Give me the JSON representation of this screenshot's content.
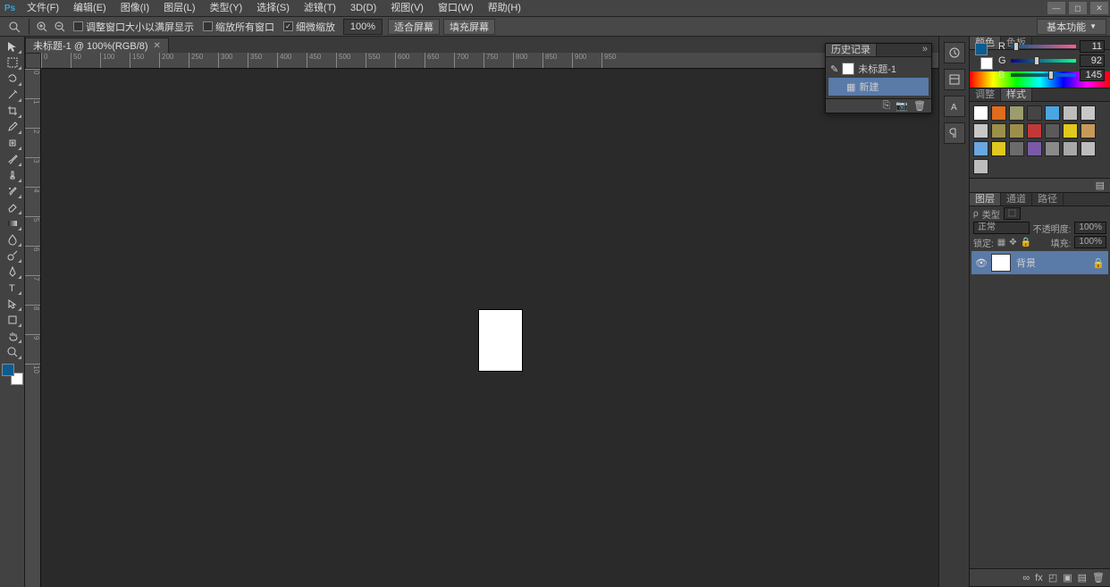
{
  "menu": {
    "items": [
      "文件(F)",
      "编辑(E)",
      "图像(I)",
      "图层(L)",
      "类型(Y)",
      "选择(S)",
      "滤镜(T)",
      "3D(D)",
      "视图(V)",
      "窗口(W)",
      "帮助(H)"
    ]
  },
  "window_controls": {
    "min": "—",
    "max": "◻",
    "close": "✕"
  },
  "options_bar": {
    "resize_to_fit": "调整窗口大小以满屏显示",
    "zoom_all": "缩放所有窗口",
    "scrubby": "细微缩放",
    "zoom_value": "100%",
    "fit_screen": "适合屏幕",
    "fill_screen": "填充屏幕",
    "workspace": "基本功能"
  },
  "document": {
    "tab_label": "未标题-1 @ 100%(RGB/8)",
    "ruler_h": [
      "0",
      "50",
      "100",
      "150",
      "200",
      "250",
      "300",
      "350",
      "400",
      "450",
      "500",
      "550",
      "600",
      "650",
      "700",
      "750",
      "800",
      "850",
      "900",
      "950"
    ],
    "ruler_v": [
      "0",
      "1",
      "2",
      "3",
      "4",
      "5",
      "6",
      "7",
      "8",
      "9",
      "10"
    ]
  },
  "history_panel": {
    "tab": "历史记录",
    "doc_name": "未标题-1",
    "new": "新建"
  },
  "color_panel": {
    "tabs": [
      "颜色",
      "色板"
    ],
    "r": {
      "label": "R",
      "value": "11",
      "knob_pct": 4
    },
    "g": {
      "label": "G",
      "value": "92",
      "knob_pct": 36
    },
    "b": {
      "label": "B",
      "value": "145",
      "knob_pct": 57
    }
  },
  "styles_panel": {
    "tabs": [
      "调整",
      "样式"
    ],
    "swatches": [
      "#ffffff",
      "#e06c1e",
      "#9c9c6c",
      "#454545",
      "#4aa6e0",
      "#bdbdbd",
      "#c7c7c7",
      "#c7c7c7",
      "#9c8f4a",
      "#9c8f4a",
      "#c23838",
      "#5a5a5a",
      "#e0c81e",
      "#c79a5a",
      "#6aa6e0",
      "#e0c81e",
      "#6b6b6b",
      "#7a5aa6",
      "#8a8a8a",
      "#a8a8a8",
      "#bdbdbd",
      "#bdbdbd"
    ]
  },
  "layers_panel": {
    "tabs": [
      "图层",
      "通道",
      "路径"
    ],
    "kind": "类型",
    "blend": "正常",
    "opacity_label": "不透明度:",
    "opacity": "100%",
    "lock_label": "锁定:",
    "fill_label": "填充:",
    "fill": "100%",
    "layer_name": "背景"
  },
  "tool_icons": [
    "move-tool",
    "marquee-tool",
    "lasso-tool",
    "wand-tool",
    "crop-tool",
    "eyedropper-tool",
    "heal-tool",
    "brush-tool",
    "stamp-tool",
    "history-brush-tool",
    "eraser-tool",
    "gradient-tool",
    "blur-tool",
    "dodge-tool",
    "pen-tool",
    "type-tool",
    "path-select-tool",
    "shape-tool",
    "hand-tool",
    "zoom-tool"
  ]
}
